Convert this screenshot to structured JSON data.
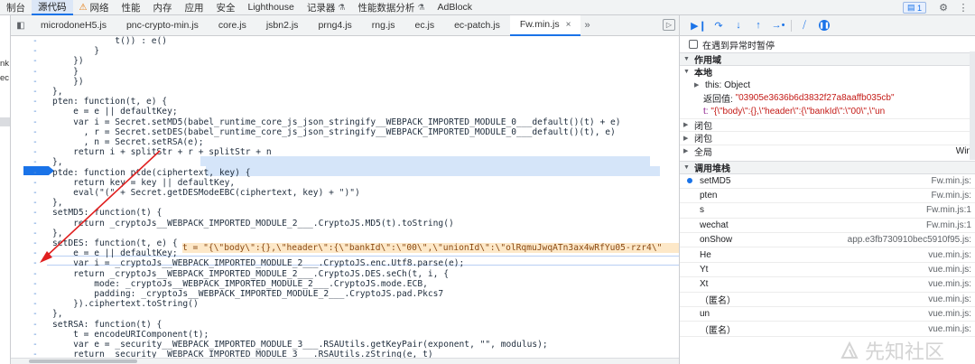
{
  "topbar": {
    "tabs": [
      {
        "label": "制台",
        "icon": ""
      },
      {
        "label": "源代码",
        "icon": "",
        "active": true
      },
      {
        "label": "网络",
        "icon": "warning-icon"
      },
      {
        "label": "性能",
        "icon": ""
      },
      {
        "label": "内存",
        "icon": ""
      },
      {
        "label": "应用",
        "icon": ""
      },
      {
        "label": "安全",
        "icon": ""
      },
      {
        "label": "Lighthouse",
        "icon": ""
      },
      {
        "label": "记录器",
        "icon": "",
        "suffix": "flask-icon"
      },
      {
        "label": "性能数据分析",
        "icon": "",
        "suffix": "flask-icon"
      },
      {
        "label": "AdBlock",
        "icon": ""
      }
    ],
    "issues_badge": "1"
  },
  "leftpane": {
    "fragments": [
      "nk",
      "ec"
    ]
  },
  "file_tabs": [
    {
      "label": "microdoneH5.js"
    },
    {
      "label": "pnc-crypto-min.js"
    },
    {
      "label": "core.js"
    },
    {
      "label": "jsbn2.js"
    },
    {
      "label": "prng4.js"
    },
    {
      "label": "rng.js"
    },
    {
      "label": "ec.js"
    },
    {
      "label": "ec-patch.js"
    },
    {
      "label": "Fw.min.js",
      "active": true
    }
  ],
  "code": {
    "gutter_marker": "-",
    "lines": [
      "            t()) : e()",
      "        }",
      "    })",
      "    }",
      "    })",
      "},",
      "pten: function(t, e) {",
      "    e = e || defaultKey;",
      "    var i = Secret.setMD5(babel_runtime_core_js_json_stringify__WEBPACK_IMPORTED_MODULE_0___default()(t) + e)",
      "      , r = Secret.setDES(babel_runtime_core_js_json_stringify__WEBPACK_IMPORTED_MODULE_0___default()(t), e)",
      "      , n = Secret.setRSA(e);",
      "    return i + splitStr + r + splitStr + n",
      "},",
      "ptde: function ptde(ciphertext, key) {",
      "    return key = key || defaultKey,",
      "    eval(\"(\" + Secret.getDESModeEBC(ciphertext, key) + \")\")",
      "},",
      "setMD5: function(t) {",
      "    return _cryptoJs__WEBPACK_IMPORTED_MODULE_2___.CryptoJS.MD5(t).toString()",
      "},",
      "setDES: function(t, e) {",
      "    e = e || defaultKey;",
      "    var i = _cryptoJs__WEBPACK_IMPORTED_MODULE_2___.CryptoJS.enc.Utf8.parse(e);",
      "    return _cryptoJs__WEBPACK_IMPORTED_MODULE_2___.CryptoJS.DES.seCh(t, i, {",
      "        mode: _cryptoJs__WEBPACK_IMPORTED_MODULE_2___.CryptoJS.mode.ECB,",
      "        padding: _cryptoJs__WEBPACK_IMPORTED_MODULE_2___.CryptoJS.pad.Pkcs7",
      "    }).ciphertext.toString()",
      "},",
      "setRSA: function(t) {",
      "    t = encodeURIComponent(t);",
      "    var e = _security__WEBPACK_IMPORTED_MODULE_3___.RSAUtils.getKeyPair(exponent, \"\", modulus);",
      "    return _security__WEBPACK_IMPORTED_MODULE_3___.RSAUtils.zString(e, t)"
    ],
    "inline_value": "t = \"{\\\"body\\\":{},\\\"header\\\":{\\\"bankId\\\":\\\"00\\\",\\\"unionId\\\":\\\"olRqmuJwqATn3ax4wRfYu05-rzr4\\\""
  },
  "debugger": {
    "pause_on_exception_label": "在遇到异常时暂停",
    "scope_title": "作用域",
    "local_label": "本地",
    "this_key": "this:",
    "this_value": "Object",
    "return_key": "返回值:",
    "return_value": "\"03905e3636b6d3832f27a8aaffb035cb\"",
    "t_key": "t:",
    "t_value": "\"{\\\"body\\\":{},\\\"header\\\":{\\\"bankId\\\":\\\"00\\\",\\\"un",
    "closure1": "闭包",
    "closure2": "闭包",
    "global_label": "全局",
    "global_value": "Win",
    "callstack_title": "调用堆栈",
    "frames": [
      {
        "name": "setMD5",
        "loc": "Fw.min.js:"
      },
      {
        "name": "pten",
        "loc": "Fw.min.js:"
      },
      {
        "name": "s",
        "loc": "Fw.min.js:1"
      },
      {
        "name": "wechat",
        "loc": "Fw.min.js:1"
      },
      {
        "name": "onShow",
        "loc": "app.e3fb730910bec5910f95.js:"
      },
      {
        "name": "He",
        "loc": "vue.min.js:"
      },
      {
        "name": "Yt",
        "loc": "vue.min.js:"
      },
      {
        "name": "Xt",
        "loc": "vue.min.js:"
      },
      {
        "name": "（匿名）",
        "loc": "vue.min.js:"
      },
      {
        "name": "un",
        "loc": "vue.min.js:"
      },
      {
        "name": "（匿名）",
        "loc": "vue.min.js:"
      }
    ]
  },
  "watermark": "先知社区"
}
